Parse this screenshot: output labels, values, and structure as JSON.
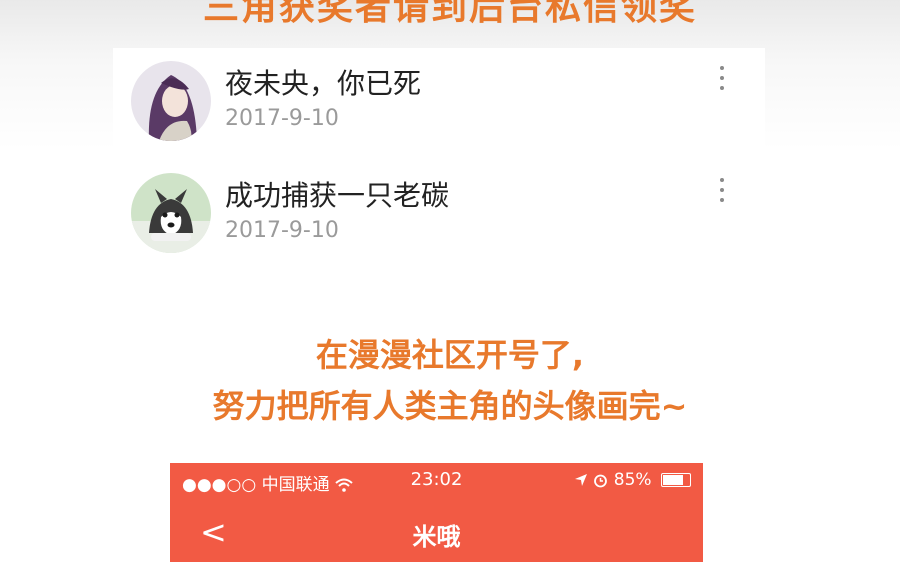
{
  "top_caption": "三角获奖者请到后台私信领奖",
  "posts": [
    {
      "title": "夜未央，你已死",
      "date": "2017-9-10",
      "avatar_icon": "anime-girl-avatar"
    },
    {
      "title": "成功捕获一只老碳",
      "date": "2017-9-10",
      "avatar_icon": "husky-dog-avatar"
    }
  ],
  "caption_line1": "在漫漫社区开号了,",
  "caption_line2": "努力把所有人类主角的头像画完~",
  "phone": {
    "status_left": "●●●○○ 中国联通",
    "wifi_icon": "wifi-icon",
    "time": "23:02",
    "battery": "85%",
    "battery_level": 0.85,
    "back": "<",
    "title": "米哦"
  },
  "colors": {
    "accent": "#e8792c",
    "header": "#f25a44"
  }
}
